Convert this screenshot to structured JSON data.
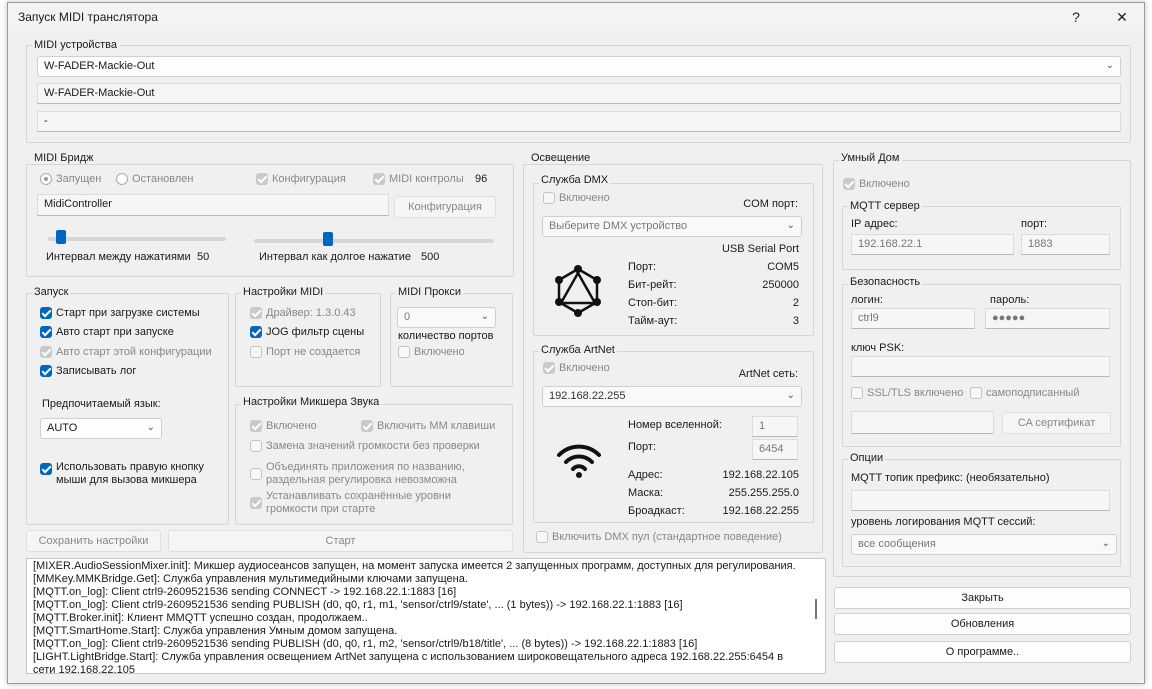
{
  "window": {
    "title": "Запуск MIDI транслятора",
    "help": "?",
    "close": "✕"
  },
  "midi_devices": {
    "label": "MIDI устройства",
    "selected": "W-FADER-Mackie-Out",
    "field1": "W-FADER-Mackie-Out",
    "field2": "-"
  },
  "midi_bridge": {
    "label": "MIDI Бридж",
    "running": "Запущен",
    "stopped": "Остановлен",
    "config_cb": "Конфигурация",
    "midi_controls": "MIDI контролы",
    "midi_controls_count": "96",
    "name": "MidiController",
    "config_button": "Конфигурация",
    "interval_press_label": "Интервал между нажатиями",
    "interval_press_value": "50",
    "interval_long_label": "Интервал как долгое нажатие",
    "interval_long_value": "500",
    "interval_press_level": 0.05,
    "interval_long_level": 0.3
  },
  "startup": {
    "label": "Запуск",
    "start_on_boot": "Старт при загрузке системы",
    "auto_start": "Авто старт при запуске",
    "auto_start_config": "Авто старт этой конфигурации",
    "write_log": "Записывать лог",
    "lang_label": "Предпочитаемый язык:",
    "lang_value": "AUTO",
    "right_button_line1": "Использовать правую кнопку",
    "right_button_line2": "мыши для вызова микшера"
  },
  "midi_settings": {
    "label": "Настройки MIDI",
    "driver": "Драйвер: 1.3.0.43",
    "jog_filter": "JOG фильтр сцены",
    "port_not_created": "Порт не создается"
  },
  "midi_proxy": {
    "label": "MIDI Прокси",
    "count_value": "0",
    "count_label": "количество портов",
    "enabled": "Включено"
  },
  "mixer_settings": {
    "label": "Настройки Микшера Звука",
    "enabled": "Включено",
    "mm_keys": "Включить ММ клавиши",
    "replace_volume": "Замена значений громкости без проверки",
    "merge_apps_1": "Объединять приложения по названию,",
    "merge_apps_2": "раздельная регулировка невозможна",
    "restore_volume_1": "Устанавливать сохранённые уровни",
    "restore_volume_2": "громкости при старте"
  },
  "buttons": {
    "save_settings": "Сохранить настройки",
    "start": "Старт",
    "close": "Закрыть",
    "updates": "Обновления",
    "about": "О программе.."
  },
  "lighting": {
    "label": "Освещение",
    "dmx": {
      "label": "Служба DMX",
      "enabled": "Включено",
      "com_label": "COM порт:",
      "device_placeholder": "Выберите DMX устройство",
      "device_name": "USB Serial Port",
      "port_label": "Порт:",
      "port_value": "COM5",
      "baud_label": "Бит-рейт:",
      "baud_value": "250000",
      "stop_label": "Стоп-бит:",
      "stop_value": "2",
      "timeout_label": "Тайм-аут:",
      "timeout_value": "3"
    },
    "artnet": {
      "label": "Служба ArtNet",
      "enabled": "Включено",
      "net_label": "ArtNet сеть:",
      "net_value": "192.168.22.255",
      "universe_label": "Номер вселенной:",
      "universe_value": "1",
      "port_label": "Порт:",
      "port_value": "6454",
      "address_label": "Адрес:",
      "address_value": "192.168.22.105",
      "mask_label": "Маска:",
      "mask_value": "255.255.255.0",
      "broadcast_label": "Броадкаст:",
      "broadcast_value": "192.168.22.255"
    },
    "dmx_pool": "Включить DMX пул (стандартное поведение)"
  },
  "smart_home": {
    "label": "Умный Дом",
    "enabled": "Включено",
    "mqtt_server": {
      "label": "MQTT сервер",
      "ip_label": "IP адрес:",
      "ip_value": "192.168.22.1",
      "port_label": "порт:",
      "port_value": "1883"
    },
    "security": {
      "label": "Безопасность",
      "login_label": "логин:",
      "login_value": "ctrl9",
      "password_label": "пароль:",
      "password_value": "●●●●●",
      "psk_label": "ключ PSK:",
      "ssl": "SSL/TLS включено",
      "self_signed": "самоподписанный",
      "ca_button": "CA сертификат"
    },
    "options": {
      "label": "Опции",
      "topic_label": "MQTT топик префикс: (необязательно)",
      "log_level_label": "уровень логирования MQTT сессий:",
      "log_level_value": "все сообщения"
    }
  },
  "log": [
    "[MIXER.AudioSessionMixer.init]: Микшер аудиосеансов запущен, на момент запуска имеется 2 запущенных программ, доступных для регулирования.",
    "[MMKey.MMKBridge.Get]: Служба управления мультимедийными ключами запущена.",
    "[MQTT.on_log]: Client ctrl9-2609521536 sending CONNECT -> 192.168.22.1:1883 [16]",
    "[MQTT.on_log]: Client ctrl9-2609521536 sending PUBLISH (d0, q0, r1, m1, 'sensor/ctrl9/state', ... (1 bytes)) -> 192.168.22.1:1883 [16]",
    "[MQTT.Broker.init]: Клиент MMQTT успешно создан, продолжаем..",
    "[MQTT.SmartHome.Start]: Служба управления Умным домом запущена.",
    "[MQTT.on_log]: Client ctrl9-2609521536 sending PUBLISH (d0, q0, r1, m2, 'sensor/ctrl9/b18/title', ... (8 bytes)) -> 192.168.22.1:1883 [16]",
    "[LIGHT.LightBridge.Start]: Служба управления освещением ArtNet запущена с использованием широковещательного адреса 192.168.22.255:6454 в",
    "сети 192.168.22.105"
  ]
}
